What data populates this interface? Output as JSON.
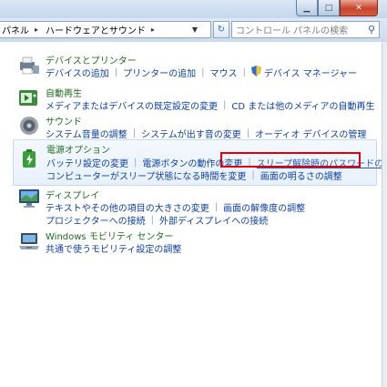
{
  "window": {
    "min_glyph": "▁",
    "max_glyph": "□",
    "close_glyph": "✕"
  },
  "breadcrumb": {
    "items": [
      "パネル",
      "ハードウェアとサウンド"
    ],
    "sep": "▸"
  },
  "search": {
    "placeholder": "コントロール パネルの検索"
  },
  "groups": [
    {
      "title": "デバイスとプリンター",
      "icon": "printer-icon",
      "rows": [
        [
          "デバイスの追加",
          "プリンターの追加",
          "マウス",
          "デバイス マネージャー"
        ]
      ]
    },
    {
      "title": "自動再生",
      "icon": "autoplay-icon",
      "rows": [
        [
          "メディアまたはデバイスの既定設定の変更",
          "CD または他のメディアの自動再生"
        ]
      ]
    },
    {
      "title": "サウンド",
      "icon": "speaker-icon",
      "rows": [
        [
          "システム音量の調整",
          "システムが出す音の変更",
          "オーディオ デバイスの管理"
        ]
      ]
    },
    {
      "title": "電源オプション",
      "icon": "battery-icon",
      "rows": [
        [
          "バッテリ設定の変更",
          "電源ボタンの動作の変更",
          "スリープ解除時のパスワードの要求"
        ],
        [
          "コンピューターがスリープ状態になる時間を変更",
          "画面の明るさの調整"
        ]
      ]
    },
    {
      "title": "ディスプレイ",
      "icon": "display-icon",
      "rows": [
        [
          "テキストやその他の項目の大きさの変更",
          "画面の解像度の調整"
        ],
        [
          "プロジェクターへの接続",
          "外部ディスプレイへの接続"
        ]
      ]
    },
    {
      "title": "Windows モビリティ センター",
      "icon": "mobility-icon",
      "rows": [
        [
          "共通で使うモビリティ設定の調整"
        ]
      ]
    }
  ]
}
